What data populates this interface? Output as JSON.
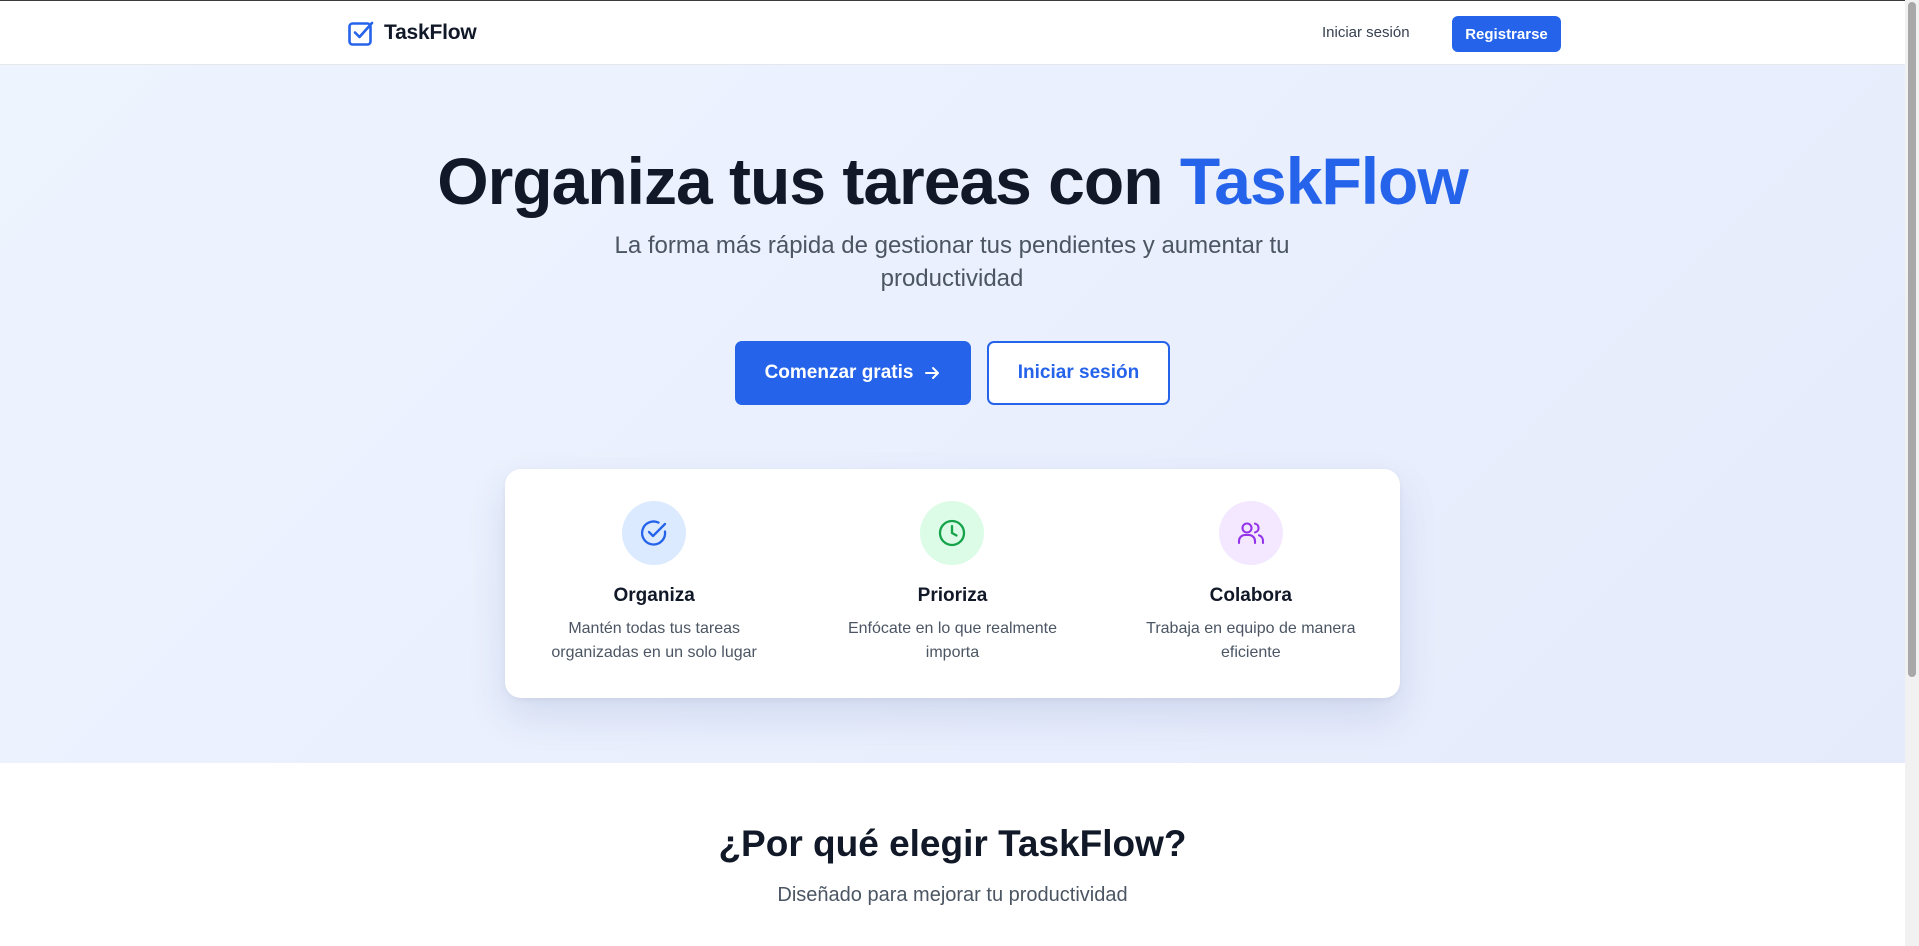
{
  "header": {
    "brand": "TaskFlow",
    "login_label": "Iniciar sesión",
    "signup_label": "Registrarse"
  },
  "hero": {
    "title_main": "Organiza tus tareas con ",
    "title_accent": "TaskFlow",
    "subtitle": "La forma más rápida de gestionar tus pendientes y aumentar tu productividad",
    "primary_button": "Comenzar gratis",
    "secondary_button": "Iniciar sesión"
  },
  "features": [
    {
      "icon": "check-circle-icon",
      "title": "Organiza",
      "description": "Mantén todas tus tareas organizadas en un solo lugar",
      "icon_color": "#2563eb",
      "icon_bg": "#dbeafe"
    },
    {
      "icon": "clock-icon",
      "title": "Prioriza",
      "description": "Enfócate en lo que realmente importa",
      "icon_color": "#16a34a",
      "icon_bg": "#dcfce7"
    },
    {
      "icon": "users-icon",
      "title": "Colabora",
      "description": "Trabaja en equipo de manera eficiente",
      "icon_color": "#9333ea",
      "icon_bg": "#f3e8ff"
    }
  ],
  "why": {
    "title": "¿Por qué elegir TaskFlow?",
    "subtitle": "Diseñado para mejorar tu productividad"
  },
  "colors": {
    "accent": "#2563eb",
    "text_dark": "#111827",
    "text_muted": "#4b5563"
  }
}
